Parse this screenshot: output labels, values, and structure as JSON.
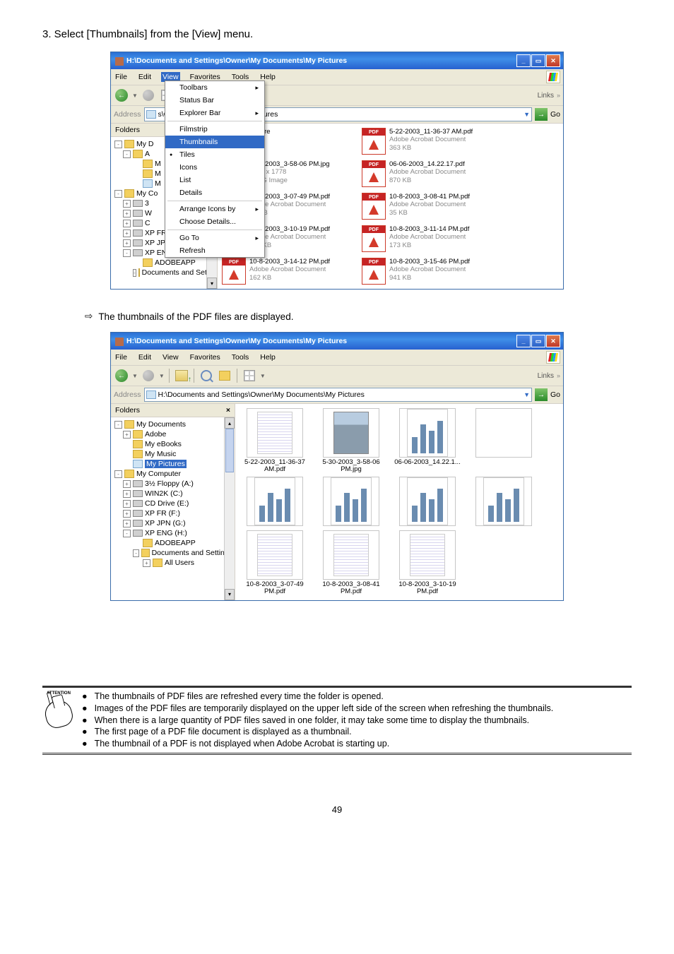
{
  "step_text": "3.   Select [Thumbnails] from the [View] menu.",
  "page_number": "49",
  "window1": {
    "title": "H:\\Documents and Settings\\Owner\\My Documents\\My Pictures",
    "menus": [
      "File",
      "Edit",
      "View",
      "Favorites",
      "Tools",
      "Help"
    ],
    "selected_menu": "View",
    "go": "Go",
    "links": "Links",
    "address": "s\\Owner\\My Documents\\My Pictures",
    "folders_label": "Folders",
    "view_menu": {
      "toolbars": "Toolbars",
      "statusbar": "Status Bar",
      "explorerbar": "Explorer Bar",
      "filmstrip": "Filmstrip",
      "thumbnails": "Thumbnails",
      "tiles": "Tiles",
      "icons": "Icons",
      "list": "List",
      "details": "Details",
      "arrange": "Arrange Icons by",
      "choose": "Choose Details...",
      "goto": "Go To",
      "refresh": "Refresh"
    },
    "tree": [
      "My D",
      "A",
      "M",
      "M",
      "M",
      "My Co",
      "3",
      "W",
      "C",
      "XP FR (F:)",
      "XP JPN (G:)",
      "XP ENG (H:)",
      "ADOBEAPP",
      "Documents and Settings"
    ],
    "files": [
      {
        "name": "Picture",
        "l2": "",
        "l3": "",
        "type": "gray"
      },
      {
        "name": "5-22-2003_11-36-37 AM.pdf",
        "l2": "Adobe Acrobat Document",
        "l3": "363 KB",
        "type": "pdf"
      },
      {
        "name": "5-30-2003_3-58-06 PM.jpg",
        "l2": "1224 x 1778",
        "l3": "JPEG Image",
        "type": "img"
      },
      {
        "name": "06-06-2003_14.22.17.pdf",
        "l2": "Adobe Acrobat Document",
        "l3": "870 KB",
        "type": "pdf"
      },
      {
        "name": "10-8-2003_3-07-49 PM.pdf",
        "l2": "Adobe Acrobat Document",
        "l3": "35 KB",
        "type": "pdf"
      },
      {
        "name": "10-8-2003_3-08-41 PM.pdf",
        "l2": "Adobe Acrobat Document",
        "l3": "35 KB",
        "type": "pdf"
      },
      {
        "name": "10-8-2003_3-10-19 PM.pdf",
        "l2": "Adobe Acrobat Document",
        "l3": "157 KB",
        "type": "pdf"
      },
      {
        "name": "10-8-2003_3-11-14 PM.pdf",
        "l2": "Adobe Acrobat Document",
        "l3": "173 KB",
        "type": "pdf"
      },
      {
        "name": "10-8-2003_3-14-12 PM.pdf",
        "l2": "Adobe Acrobat Document",
        "l3": "162 KB",
        "type": "pdf"
      },
      {
        "name": "10-8-2003_3-15-46 PM.pdf",
        "l2": "Adobe Acrobat Document",
        "l3": "941 KB",
        "type": "pdf"
      }
    ]
  },
  "result_text": "The thumbnails of the PDF files are displayed.",
  "window2": {
    "title": "H:\\Documents and Settings\\Owner\\My Documents\\My Pictures",
    "menus": [
      "File",
      "Edit",
      "View",
      "Favorites",
      "Tools",
      "Help"
    ],
    "address_label": "Address",
    "address": "H:\\Documents and Settings\\Owner\\My Documents\\My Pictures",
    "go": "Go",
    "links": "Links",
    "folders_label": "Folders",
    "tree": [
      {
        "ind": 0,
        "toggle": "-",
        "label": "My Documents",
        "icon": "folder"
      },
      {
        "ind": 1,
        "toggle": "+",
        "label": "Adobe",
        "icon": "folder"
      },
      {
        "ind": 1,
        "toggle": "",
        "label": "My eBooks",
        "icon": "folder"
      },
      {
        "ind": 1,
        "toggle": "",
        "label": "My Music",
        "icon": "folder"
      },
      {
        "ind": 1,
        "toggle": "",
        "label": "My Pictures",
        "icon": "pic",
        "selected": true
      },
      {
        "ind": 0,
        "toggle": "-",
        "label": "My Computer",
        "icon": "pc"
      },
      {
        "ind": 1,
        "toggle": "+",
        "label": "3½ Floppy (A:)",
        "icon": "drive"
      },
      {
        "ind": 1,
        "toggle": "+",
        "label": "WIN2K (C:)",
        "icon": "drive"
      },
      {
        "ind": 1,
        "toggle": "+",
        "label": "CD Drive (E:)",
        "icon": "drive"
      },
      {
        "ind": 1,
        "toggle": "+",
        "label": "XP FR (F:)",
        "icon": "drive"
      },
      {
        "ind": 1,
        "toggle": "+",
        "label": "XP JPN (G:)",
        "icon": "drive"
      },
      {
        "ind": 1,
        "toggle": "-",
        "label": "XP ENG (H:)",
        "icon": "drive"
      },
      {
        "ind": 2,
        "toggle": "",
        "label": "ADOBEAPP",
        "icon": "folder"
      },
      {
        "ind": 2,
        "toggle": "-",
        "label": "Documents and Settings",
        "icon": "folder"
      },
      {
        "ind": 3,
        "toggle": "+",
        "label": "All Users",
        "icon": "folder"
      }
    ],
    "thumbs": [
      {
        "label": "5-22-2003_11-36-37 AM.pdf",
        "t": "doc"
      },
      {
        "label": "5-30-2003_3-58-06 PM.jpg",
        "t": "photo"
      },
      {
        "label": "06-06-2003_14.22.1...",
        "t": "bars"
      },
      {
        "label": "",
        "t": "blank"
      },
      {
        "label": "",
        "t": "bars"
      },
      {
        "label": "",
        "t": "bars"
      },
      {
        "label": "",
        "t": "bars"
      },
      {
        "label": "",
        "t": "bars"
      },
      {
        "label": "10-8-2003_3-07-49 PM.pdf",
        "t": "doc"
      },
      {
        "label": "10-8-2003_3-08-41 PM.pdf",
        "t": "doc"
      },
      {
        "label": "10-8-2003_3-10-19 PM.pdf",
        "t": "doc"
      }
    ]
  },
  "attention": [
    "The thumbnails of PDF files are refreshed every time the folder is opened.",
    "Images of the PDF files are temporarily displayed on the upper left side of the screen when refreshing the thumbnails.",
    "When there is a large quantity of PDF files saved in one folder, it may take some time to display the thumbnails.",
    "The first page of a PDF file document is displayed as a thumbnail.",
    "The thumbnail of a PDF is not displayed when Adobe Acrobat is starting up."
  ],
  "attention_label": "ATTENTION"
}
